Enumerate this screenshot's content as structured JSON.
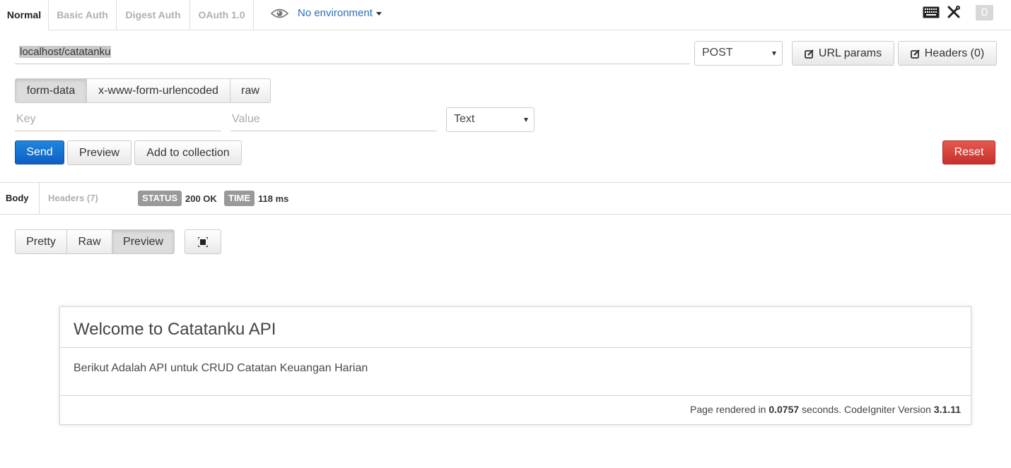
{
  "auth_tabs": [
    {
      "label": "Normal",
      "active": true
    },
    {
      "label": "Basic Auth",
      "active": false
    },
    {
      "label": "Digest Auth",
      "active": false
    },
    {
      "label": "OAuth 1.0",
      "active": false
    }
  ],
  "environment": {
    "label": "No environment",
    "icon": "eye-icon"
  },
  "top_right": {
    "keyboard_icon": "keyboard-icon",
    "tools_icon": "wrench-screwdriver-icon",
    "counter": "0"
  },
  "request": {
    "url": "localhost/catatanku",
    "method": "POST",
    "url_params_label": "URL params",
    "headers_label": "Headers (0)"
  },
  "body_types": [
    {
      "label": "form-data",
      "active": true
    },
    {
      "label": "x-www-form-urlencoded",
      "active": false
    },
    {
      "label": "raw",
      "active": false
    }
  ],
  "form_row": {
    "key_placeholder": "Key",
    "value_placeholder": "Value",
    "type": "Text"
  },
  "actions": {
    "send": "Send",
    "preview": "Preview",
    "add_to_collection": "Add to collection",
    "reset": "Reset"
  },
  "response": {
    "tabs": [
      {
        "label": "Body",
        "active": true
      },
      {
        "label": "Headers (7)",
        "active": false
      }
    ],
    "status_label": "STATUS",
    "status_value": "200 OK",
    "time_label": "TIME",
    "time_value": "118 ms",
    "view_modes": [
      {
        "label": "Pretty",
        "active": false
      },
      {
        "label": "Raw",
        "active": false
      },
      {
        "label": "Preview",
        "active": true
      }
    ],
    "fullscreen_icon": "fullscreen-icon"
  },
  "preview_page": {
    "title": "Welcome to Catatanku API",
    "body": "Berikut Adalah API untuk CRUD Catatan Keuangan Harian",
    "footer_prefix": "Page rendered in ",
    "footer_seconds": "0.0757",
    "footer_middle": " seconds. CodeIgniter Version ",
    "footer_version": "3.1.11"
  },
  "colors": {
    "accent": "#2a6fb8",
    "send": "#0d5fc2",
    "reset": "#c9302c",
    "badge": "#999999"
  }
}
